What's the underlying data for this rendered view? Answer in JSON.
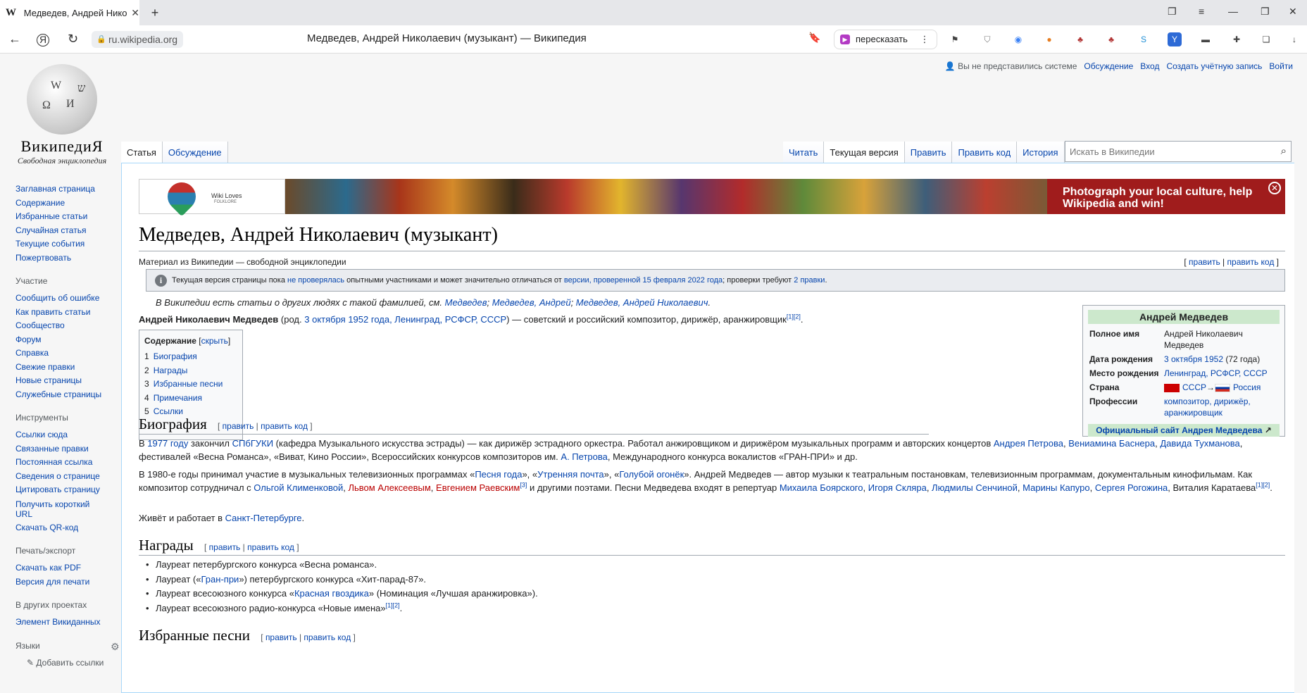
{
  "browser": {
    "tab_title": "Медведев, Андрей Николаевич (музыкант) — Википедия",
    "tab_favicon": "W",
    "address_domain": "ru.wikipedia.org",
    "page_title": "Медведев, Андрей Николаевич (музыкант) — Википедия",
    "retell_label": "пересказать"
  },
  "wiki": {
    "wordmark": "ВикипедиЯ",
    "tagline": "Свободная энциклопедия",
    "personal": {
      "anon": "Вы не представились системе",
      "talk": "Обсуждение",
      "login": "Вход",
      "create": "Создать учётную запись",
      "logout": "Войти"
    },
    "tabs_left": [
      "Статья",
      "Обсуждение"
    ],
    "tabs_right": [
      "Читать",
      "Текущая версия",
      "Править",
      "Править код",
      "История"
    ],
    "search_placeholder": "Искать в Википедии",
    "sidebar": {
      "main": [
        "Заглавная страница",
        "Содержание",
        "Избранные статьи",
        "Случайная статья",
        "Текущие события",
        "Пожертвовать"
      ],
      "participation_title": "Участие",
      "participation": [
        "Сообщить об ошибке",
        "Как править статьи",
        "Сообщество",
        "Форум",
        "Справка",
        "Свежие правки",
        "Новые страницы",
        "Служебные страницы"
      ],
      "tools_title": "Инструменты",
      "tools": [
        "Ссылки сюда",
        "Связанные правки",
        "Постоянная ссылка",
        "Сведения о странице",
        "Цитировать страницу",
        "Получить короткий URL",
        "Скачать QR-код"
      ],
      "print_title": "Печать/экспорт",
      "print": [
        "Скачать как PDF",
        "Версия для печати"
      ],
      "projects_title": "В других проектах",
      "projects": [
        "Элемент Викиданных"
      ],
      "languages_title": "Языки",
      "add_links": "Добавить ссылки"
    },
    "banner": {
      "wlf_title": "Wiki Loves",
      "wlf_sub": "FOLKLORE",
      "message": "Photograph your local culture, help Wikipedia and win!"
    },
    "article": {
      "title": "Медведев, Андрей Николаевич (музыкант)",
      "site_sub": "Материал из Википедии — свободной энциклопедии",
      "edit": "править",
      "edit_code": "править код",
      "notice": {
        "pre": "Текущая версия страницы пока",
        "link1": "не проверялась",
        "mid": "опытными участниками и может значительно отличаться от",
        "link2": "версии, проверенной 15 февраля 2022 года",
        "post": "; проверки требуют",
        "link3": "2 правки",
        "end": "."
      },
      "hatnote": {
        "pre": "В Википедии есть статьи о других людях с такой фамилией, см.",
        "l1": "Медведев",
        "l2": "Медведев, Андрей",
        "l3": "Медведев, Андрей Николаевич",
        "end": "."
      },
      "lead": {
        "name": "Андрей Николаевич Медведев",
        "born_pre": "(род.",
        "born_link": "3 октября 1952 года, Ленинград, РСФСР, СССР",
        "rest": ") — советский и российский композитор, дирижёр, аранжировщик",
        "refs": "[1][2]",
        "end": "."
      },
      "toc": {
        "title": "Содержание",
        "hide": "скрыть",
        "items": [
          {
            "num": "1",
            "label": "Биография"
          },
          {
            "num": "2",
            "label": "Награды"
          },
          {
            "num": "3",
            "label": "Избранные песни"
          },
          {
            "num": "4",
            "label": "Примечания"
          },
          {
            "num": "5",
            "label": "Ссылки"
          }
        ]
      },
      "infobox": {
        "caption": "Андрей Медведев",
        "full_name_k": "Полное имя",
        "full_name_v": "Андрей Николаевич Медведев",
        "birth_k": "Дата рождения",
        "birth_link": "3 октября 1952",
        "birth_age": "(72 года)",
        "place_k": "Место рождения",
        "place_v": "Ленинград, РСФСР, СССР",
        "country_k": "Страна",
        "country_v1": "СССР",
        "country_arrow": "→",
        "country_v2": "Россия",
        "prof_k": "Профессии",
        "prof_v": "композитор, дирижёр, аранжировщик",
        "site": "Официальный сайт Андрея Медведева"
      },
      "bio_title": "Биография",
      "bio_p1": {
        "a": "В",
        "l1": "1977 году",
        "b": "закончил",
        "l2": "СПбГУКИ",
        "c": "(кафедра Музыкального искусства эстрады) — как дирижёр эстрадного оркестра. Работал анжировщиком и дирижёром музыкальных программ и авторских концертов",
        "l3": "Андрея Петрова",
        "l4": "Вениамина Баснера",
        "l5": "Давида Тухманова",
        "d": ", фестивалей «Весна Романса», «Виват, Кино России», Всероссийских конкурсов композиторов им.",
        "l6": "А. Петрова",
        "e": ", Международного конкурса вокалистов «ГРАН-ПРИ» и др."
      },
      "bio_p2": {
        "a": "В 1980-е годы принимал участие в музыкальных телевизионных программах «",
        "l1": "Песня года",
        "b": "», «",
        "l2": "Утренняя почта",
        "c": "», «",
        "l3": "Голубой огонёк",
        "d": "». Андрей Медведев — автор музыки к театральным постановкам, телевизионным программам, документальным кинофильмам. Как композитор сотрудничал с",
        "l4": "Ольгой Клименковой",
        "r1": "Львом Алексеевым",
        "r2": "Евгением Раевским",
        "ref3": "[3]",
        "e": "и другими поэтами. Песни Медведева входят в репертуар",
        "l5": "Михаила Боярского",
        "l6": "Игоря Скляра",
        "l7": "Людмилы Сенчиной",
        "l8": "Марины Капуро",
        "l9": "Сергея Рогожина",
        "f": ", Виталия Каратаева",
        "refs": "[1][2]",
        "g": "."
      },
      "bio_p3": {
        "a": "Живёт и работает в",
        "l1": "Санкт-Петербурге",
        "b": "."
      },
      "awards_title": "Награды",
      "awards": {
        "a1": "Лауреат петербургского конкурса «Весна романса».",
        "a2_pre": "Лауреат («",
        "a2_link": "Гран-при",
        "a2_post": "») петербургского конкурса «Хит-парад-87».",
        "a3_pre": "Лауреат всесоюзного конкурса «",
        "a3_link": "Красная гвоздика",
        "a3_post": "» (Номинация «Лучшая аранжировка»).",
        "a4": "Лауреат всесоюзного радио-конкурса «Новые имена»",
        "a4_refs": "[1][2]",
        "a4_end": "."
      },
      "songs_title": "Избранные песни"
    }
  },
  "colors": {
    "link": "#0645ad",
    "redlink": "#ba0000",
    "banner": "#a01c1c",
    "infobox_header": "#cce8cc"
  }
}
